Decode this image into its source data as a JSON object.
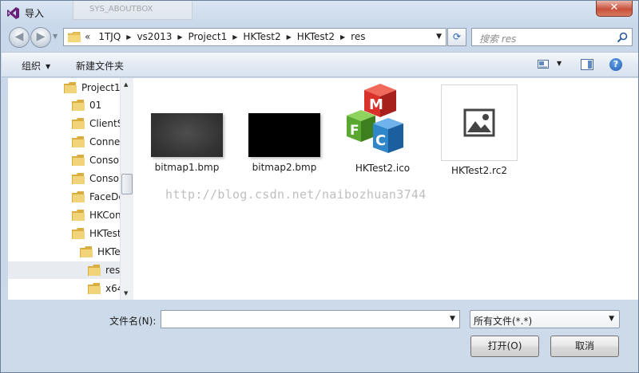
{
  "window": {
    "title": "导入",
    "close_label": "✕",
    "background_doc_label": "SYS_ABOUTBOX"
  },
  "navigation": {
    "back_label": "◀",
    "forward_label": "▶"
  },
  "address": {
    "overflow": "«",
    "breadcrumbs": [
      "1TJQ",
      "vs2013",
      "Project1",
      "HKTest2",
      "HKTest2",
      "res"
    ]
  },
  "search": {
    "placeholder": "搜索 res"
  },
  "toolbar": {
    "organize_label": "组织",
    "new_folder_label": "新建文件夹",
    "help_label": "?"
  },
  "tree": {
    "items": [
      {
        "label": "Project1"
      },
      {
        "label": "01"
      },
      {
        "label": "ClientS"
      },
      {
        "label": "Conne"
      },
      {
        "label": "Consol"
      },
      {
        "label": "Consol"
      },
      {
        "label": "FaceDe"
      },
      {
        "label": "HKCon"
      },
      {
        "label": "HKTest"
      },
      {
        "label": "HKTe"
      },
      {
        "label": "res"
      },
      {
        "label": "x64"
      }
    ]
  },
  "files": [
    {
      "name": "bitmap1.bmp",
      "kind": "bmp-dark-gray"
    },
    {
      "name": "bitmap2.bmp",
      "kind": "bmp-black"
    },
    {
      "name": "HKTest2.ico",
      "kind": "mfc-cubes-icon"
    },
    {
      "name": "HKTest2.rc2",
      "kind": "image-file-icon"
    }
  ],
  "mfc_icon": {
    "letters": [
      "M",
      "F",
      "C"
    ],
    "colors": {
      "red": "#d8322b",
      "green": "#5aa832",
      "blue": "#2f86c9"
    }
  },
  "watermark": "http://blog.csdn.net/naibozhuan3744",
  "bottom": {
    "filename_label": "文件名(N):",
    "filename_value": "",
    "filter_value": "所有文件(*.*)",
    "open_label": "打开(O)",
    "cancel_label": "取消"
  },
  "colors": {
    "window_frame": "#c9d8ea",
    "close_button": "#c8503a",
    "folder_yellow": "#e8c255"
  }
}
